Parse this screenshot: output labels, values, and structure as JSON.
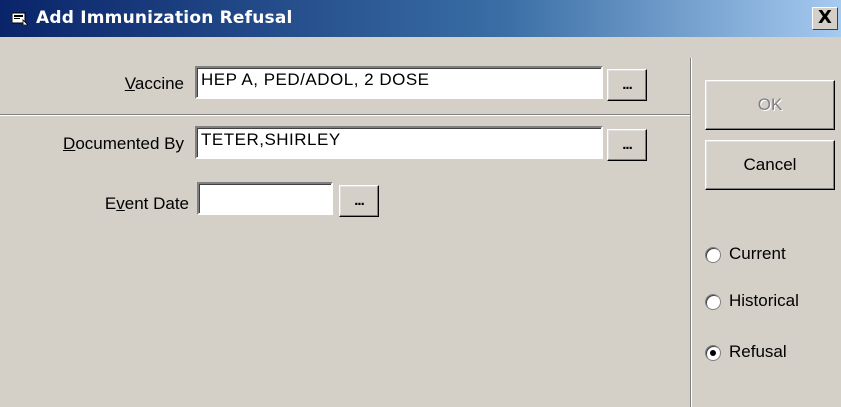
{
  "window": {
    "title": "Add Immunization Refusal",
    "close_label": "X"
  },
  "form": {
    "vaccine": {
      "label_pre": "",
      "label_key": "V",
      "label_post": "accine",
      "value": "HEP A, PED/ADOL, 2 DOSE",
      "browse_label": "..."
    },
    "documented_by": {
      "label_pre": "",
      "label_key": "D",
      "label_post": "ocumented By",
      "value": "TETER,SHIRLEY",
      "browse_label": "..."
    },
    "event_date": {
      "label_pre": "E",
      "label_key": "v",
      "label_post": "ent Date",
      "value": "",
      "browse_label": "..."
    }
  },
  "buttons": {
    "ok": "OK",
    "cancel": "Cancel"
  },
  "status_options": [
    {
      "label": "Current",
      "selected": false
    },
    {
      "label": "Historical",
      "selected": false
    },
    {
      "label": "Refusal",
      "selected": true
    }
  ]
}
